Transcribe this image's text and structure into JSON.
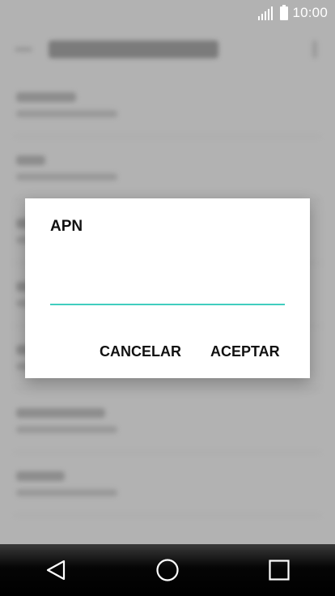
{
  "status_bar": {
    "time": "10:00",
    "icons": [
      "signal-icon",
      "battery-icon"
    ]
  },
  "dialog": {
    "title": "APN",
    "input_value": "",
    "cancel_label": "CANCELAR",
    "accept_label": "ACEPTAR"
  },
  "nav_bar": {
    "icons": [
      "back-icon",
      "home-icon",
      "recents-icon"
    ]
  },
  "colors": {
    "accent": "#41cdbf",
    "scrim": "#b2b2b2",
    "dialog_bg": "#ffffff"
  }
}
